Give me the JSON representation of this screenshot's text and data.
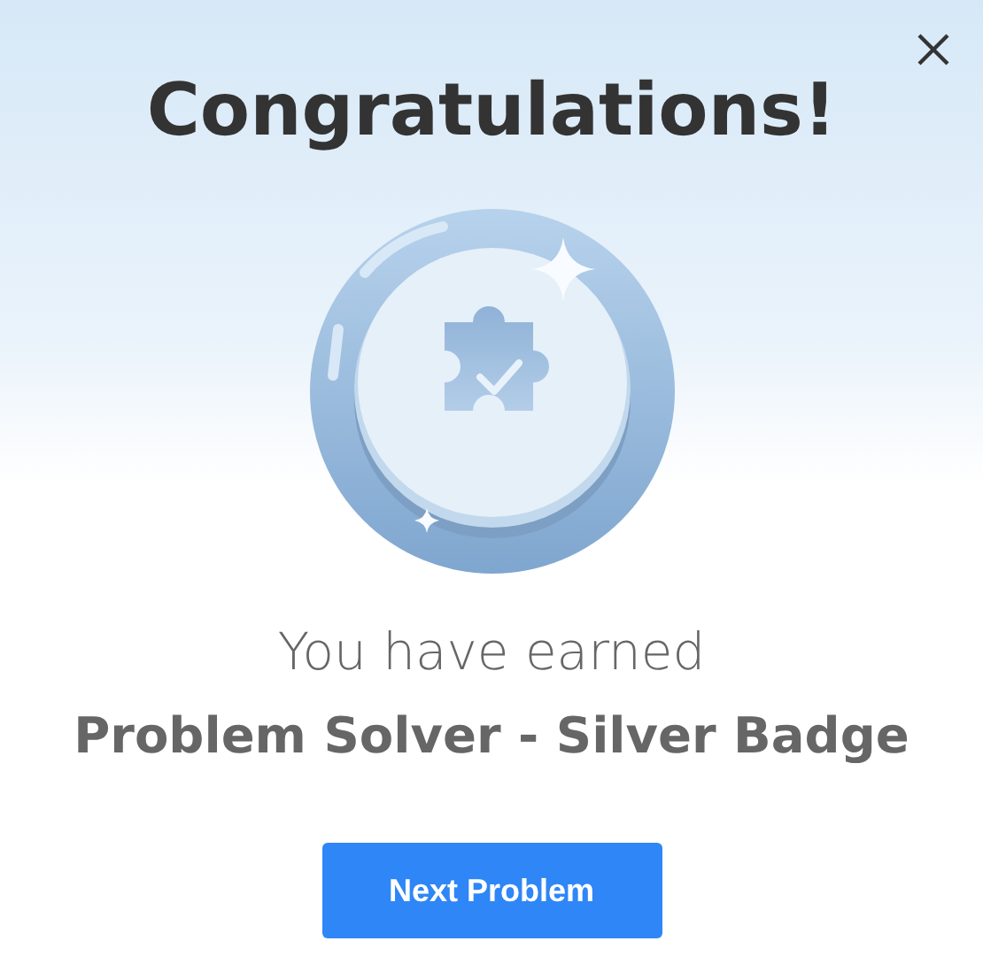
{
  "title": "Congratulations!",
  "message": "You have earned",
  "badge_name": "Problem Solver - Silver Badge",
  "button": {
    "label": "Next Problem"
  }
}
